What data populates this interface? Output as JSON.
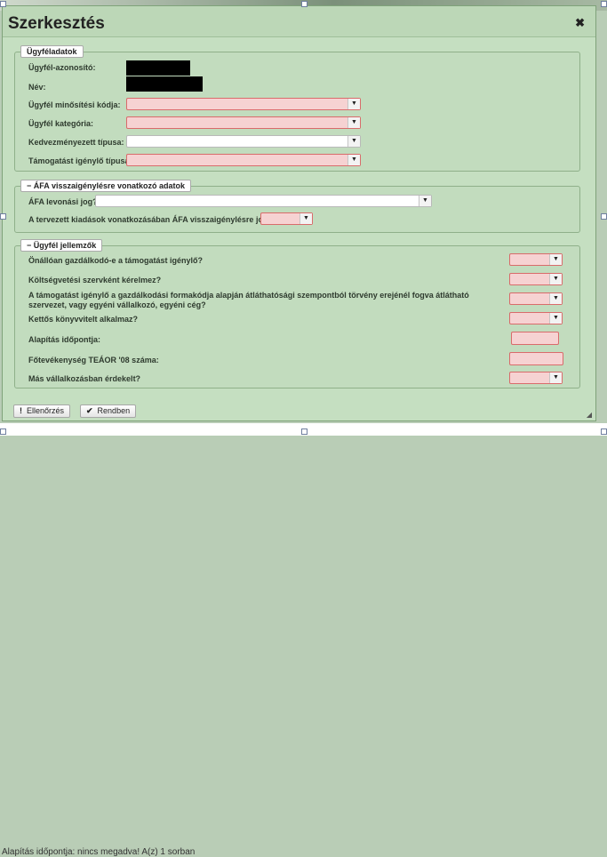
{
  "dialog": {
    "title": "Szerkesztés",
    "close_icon": "✖"
  },
  "sections": {
    "ugyfeladatok": {
      "legend": "Ügyféladatok",
      "fields": {
        "azonosito": "Ügyfél-azonosító:",
        "nev": "Név:",
        "minositesi_kod": "Ügyfél minősítési kódja:",
        "kategoria": "Ügyfél kategória:",
        "kedvezmenyezett": "Kedvezményezett típusa:",
        "tamogatast_igenylo": "Támogatást igénylő típusa:"
      }
    },
    "afa": {
      "toggle": "−",
      "legend": "ÁFA visszaigénylésre vonatkozó adatok",
      "fields": {
        "levonasi_jog": "ÁFA levonási jog?",
        "jogosult": "A tervezett kiadások vonatkozásában ÁFA visszaigénylésre jogosult?"
      }
    },
    "jellemzok": {
      "toggle": "−",
      "legend": "Ügyfél jellemzők",
      "fields": {
        "onalloan": "Önállóan gazdálkodó-e a támogatást igénylő?",
        "koltsegvetesi": "Költségvetési szervként kérelmez?",
        "atlathato": "A támogatást igénylő a gazdálkodási formakódja alapján átláthatósági szempontból törvény erejénél fogva átlátható szervezet, vagy egyéni vállalkozó, egyéni cég?",
        "kettos": "Kettős könyvvitelt alkalmaz?",
        "alapitas": "Alapítás időpontja:",
        "teaor": "Főtevékenység TEÁOR '08 száma:",
        "mas_vallalkozas": "Más vállalkozásban érdekelt?"
      }
    }
  },
  "icons": {
    "dropdown_arrow": "▼",
    "checkmark": "✔",
    "warning": "!"
  },
  "buttons": {
    "ellenorzes": "Ellenőrzés",
    "rendben": "Rendben"
  },
  "background_status": "Alapítás időpontja: nincs megadva! A(z) 1 sorban",
  "colors": {
    "dialog_bg": "#c5dfc1",
    "required_bg": "#f6d2d2",
    "required_border": "#d96b6b"
  }
}
